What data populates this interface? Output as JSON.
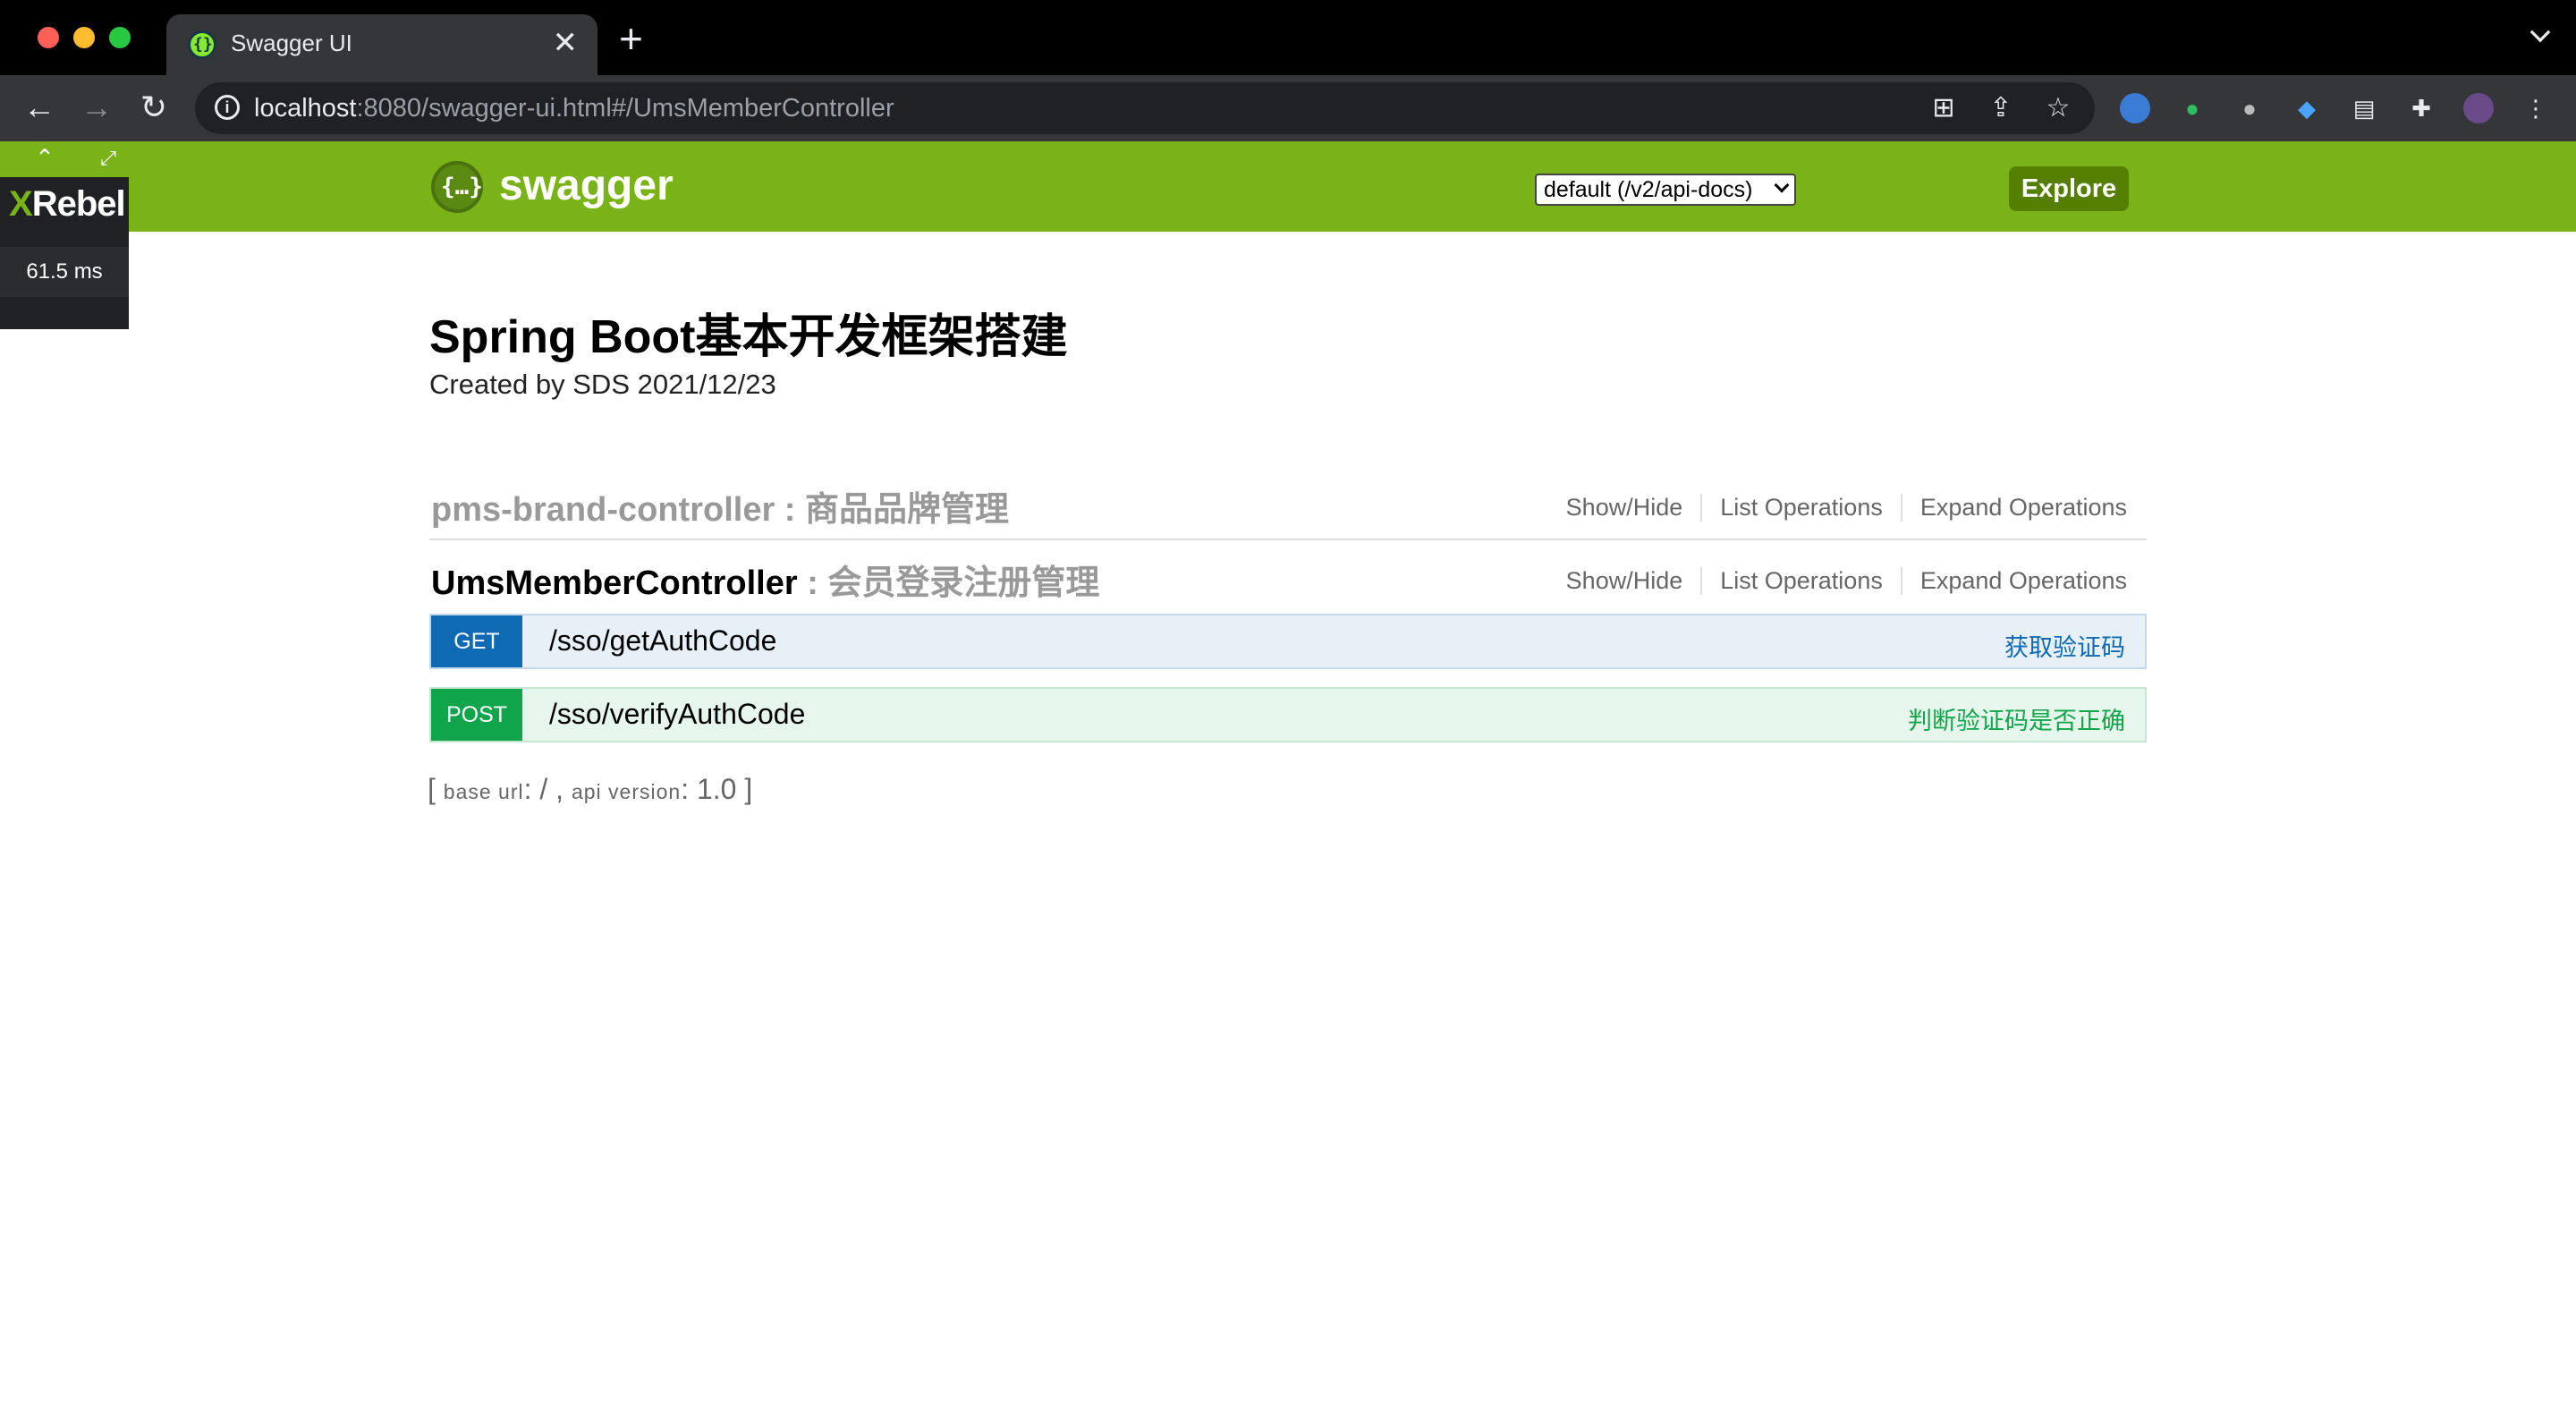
{
  "browser": {
    "tab_title": "Swagger UI",
    "tab_close": "✕",
    "new_tab": "+",
    "url_host": "localhost",
    "url_rest": ":8080/swagger-ui.html#/UmsMemberController"
  },
  "swagger": {
    "logo_text": "swagger",
    "logo_glyph": "{…}",
    "api_select_value": "default (/v2/api-docs)",
    "explore_label": "Explore"
  },
  "xrebel": {
    "logo_x": "X",
    "logo_rest": "Rebel",
    "time": "61.5 ms"
  },
  "info": {
    "title": "Spring Boot基本开发框架搭建",
    "description": "Created by SDS 2021/12/23"
  },
  "resources": [
    {
      "name": "pms-brand-controller",
      "description": " : 商品品牌管理",
      "show_hide": "Show/Hide",
      "list_ops": "List Operations",
      "expand_ops": "Expand Operations"
    },
    {
      "name": "UmsMemberController",
      "description": " : 会员登录注册管理",
      "show_hide": "Show/Hide",
      "list_ops": "List Operations",
      "expand_ops": "Expand Operations"
    }
  ],
  "operations": [
    {
      "method": "GET",
      "path": "/sso/getAuthCode",
      "summary": "获取验证码"
    },
    {
      "method": "POST",
      "path": "/sso/verifyAuthCode",
      "summary": "判断验证码是否正确"
    }
  ],
  "footer": {
    "open": "[ ",
    "base_url_label": "base url",
    "base_url_value": ": / , ",
    "api_version_label": "api version",
    "api_version_value": ": 1.0 ",
    "close": "]"
  },
  "colors": {
    "swagger_green": "#7ab317",
    "explore_bg": "#547f00",
    "get_blue": "#0f6ab4",
    "post_green": "#10a54a"
  }
}
